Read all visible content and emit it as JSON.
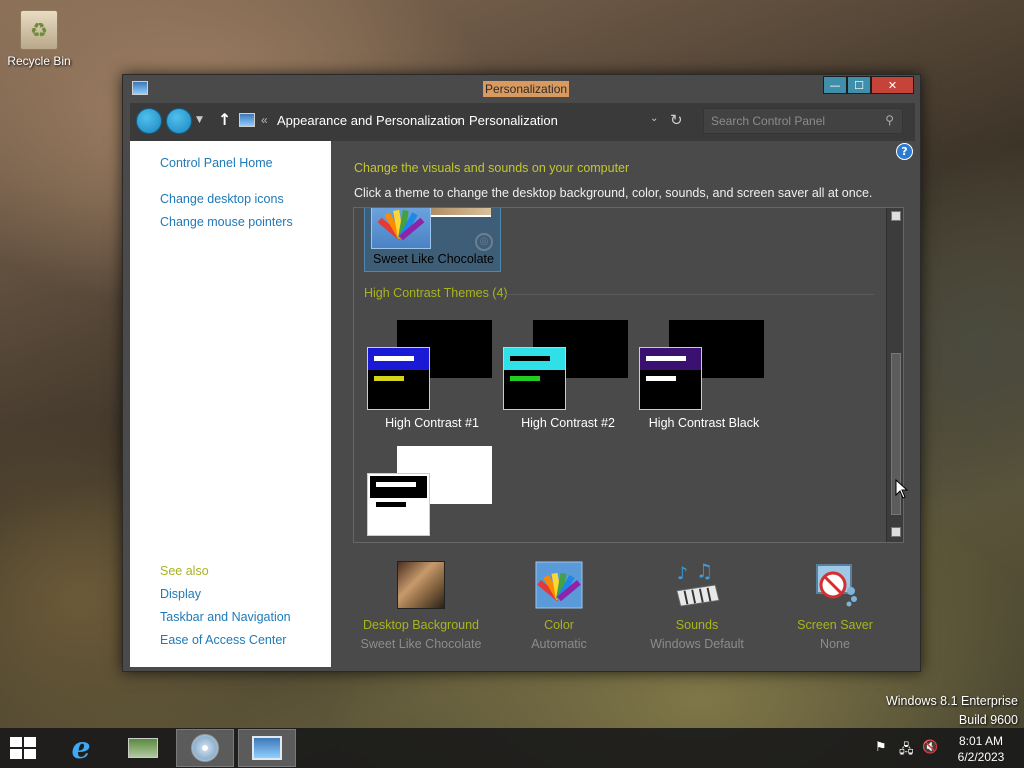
{
  "desktop": {
    "recycle_bin_label": "Recycle Bin"
  },
  "window": {
    "title": "Personalization",
    "buttons": {
      "minimize": "—",
      "maximize": "☐",
      "close": "✕"
    }
  },
  "address_bar": {
    "crumbs": [
      "Appearance and Personalization",
      "Personalization"
    ],
    "overflow": "«",
    "separator": "›",
    "search_placeholder": "Search Control Panel"
  },
  "left_pane": {
    "links": [
      "Control Panel Home",
      "Change desktop icons",
      "Change mouse pointers"
    ],
    "see_also_title": "See also",
    "see_also_links": [
      "Display",
      "Taskbar and Navigation",
      "Ease of Access Center"
    ]
  },
  "main": {
    "heading": "Change the visuals and sounds on your computer",
    "subheading": "Click a theme to change the desktop background, color, sounds, and screen saver all at once.",
    "selected_theme": "Sweet Like Chocolate",
    "high_contrast_section": "High Contrast Themes (4)",
    "high_contrast_themes": [
      {
        "name": "High Contrast #1",
        "header_color": "#1a1ad6",
        "bar1": "#ffffff",
        "bar2": "#d4d41a",
        "bg": "#000000"
      },
      {
        "name": "High Contrast #2",
        "header_color": "#2fe0e8",
        "bar1": "#000000",
        "bar2": "#22cc22",
        "bg": "#000000"
      },
      {
        "name": "High Contrast Black",
        "header_color": "#3a1070",
        "bar1": "#ffffff",
        "bar2": "#ffffff",
        "bg": "#000000"
      },
      {
        "name": "",
        "header_color": "#000000",
        "bar1": "#ffffff",
        "bar2": "#000000",
        "bg": "#ffffff"
      }
    ]
  },
  "settings": [
    {
      "label": "Desktop Background",
      "value": "Sweet Like Chocolate",
      "icon": "desktop-background-icon"
    },
    {
      "label": "Color",
      "value": "Automatic",
      "icon": "color-icon"
    },
    {
      "label": "Sounds",
      "value": "Windows Default",
      "icon": "sounds-icon"
    },
    {
      "label": "Screen Saver",
      "value": "None",
      "icon": "screen-saver-icon"
    }
  ],
  "watermark": {
    "line1": "Windows 8.1 Enterprise",
    "line2": "Build 9600"
  },
  "taskbar": {
    "time": "8:01 AM",
    "date": "6/2/2023"
  }
}
